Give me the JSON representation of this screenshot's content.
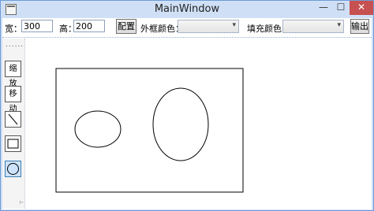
{
  "window": {
    "title": "MainWindow",
    "minimize": "—",
    "maximize": "☐",
    "close": "✕"
  },
  "toolbar": {
    "width_label": "宽：",
    "width_value": "300",
    "height_label": "高：",
    "height_value": "200",
    "config_button": "配置",
    "stroke_color_label": "外框颜色：",
    "stroke_color_value": "",
    "fill_color_label": "填充颜色：",
    "fill_color_value": "",
    "output_button": "输出"
  },
  "tools": {
    "grip": "......",
    "zoom": "缩放",
    "move": "移动",
    "line": "line",
    "rectangle": "rectangle",
    "ellipse": "ellipse",
    "active": "ellipse",
    "overflow_mark": "⊢"
  },
  "colors": {
    "title_bar": "#cfe0f6",
    "close_button": "#c75050",
    "active_tool": "#cde3fb"
  }
}
